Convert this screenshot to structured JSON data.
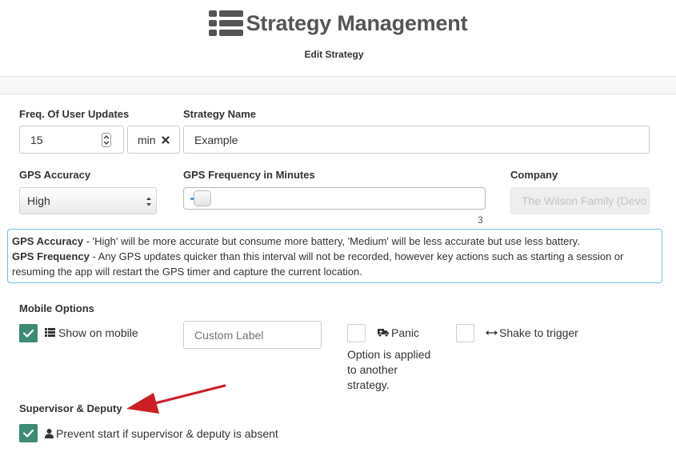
{
  "header": {
    "title": "Strategy Management",
    "subtitle": "Edit Strategy"
  },
  "form": {
    "freq_label": "Freq. Of User Updates",
    "freq_value": "15",
    "freq_unit": "min",
    "strategy_name_label": "Strategy Name",
    "strategy_name_value": "Example",
    "gps_accuracy_label": "GPS Accuracy",
    "gps_accuracy_value": "High",
    "gps_frequency_label": "GPS Frequency in Minutes",
    "gps_frequency_value": "3",
    "gps_frequency_fraction": 0.0,
    "company_label": "Company",
    "company_value": "The Wilson Family (Devo"
  },
  "info": {
    "accuracy_term": "GPS Accuracy",
    "accuracy_text": " - 'High' will be more accurate but consume more battery, 'Medium' will be less accurate but use less battery.",
    "frequency_term": "GPS Frequency",
    "frequency_text": " - Any GPS updates quicker than this interval will not be recorded, however key actions such as starting a session or resuming the app will restart the GPS timer and capture the current location."
  },
  "mobile": {
    "section_label": "Mobile Options",
    "show_on_mobile_label": "Show on mobile",
    "show_on_mobile_checked": true,
    "custom_label_placeholder": "Custom Label",
    "panic_label": "Panic",
    "panic_note": "Option is applied to another strategy.",
    "shake_label": "Shake to trigger"
  },
  "supervisor": {
    "section_label": "Supervisor & Deputy",
    "prevent_label": "Prevent start if supervisor & deputy is absent",
    "prevent_checked": true
  },
  "colors": {
    "accent": "#3d8b74",
    "info_border": "#6cc3d3",
    "arrow": "#cc1f25"
  },
  "icons": [
    "list-icon",
    "spinner-icon",
    "close-icon",
    "select-arrows-icon",
    "check-icon",
    "ambulance-icon",
    "horizontal-arrows-icon",
    "user-icon",
    "pointer-arrow"
  ]
}
